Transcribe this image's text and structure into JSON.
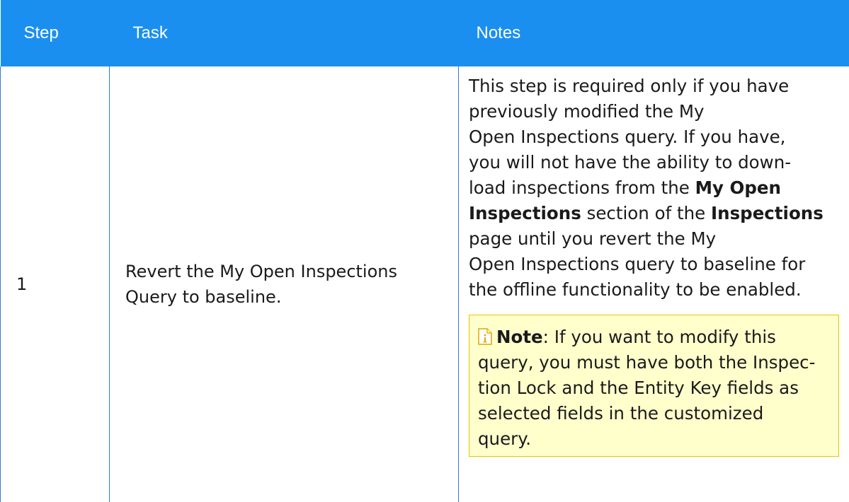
{
  "table": {
    "headers": {
      "step": "Step",
      "task": "Task",
      "notes": "Notes"
    },
    "rows": [
      {
        "step": "1",
        "task_lines": [
          "Revert the My Open Inspections",
          "Query to baseline."
        ],
        "notes_lines": {
          "l1": "This step is required only if you have",
          "l2": "previously modified the My",
          "l3": "Open Inspections query. If you have,",
          "l4": "you will not have the ability to down-",
          "l5_pre": "load inspections from the ",
          "l5_bold": "My Open",
          "l6_bold1": "Inspections",
          "l6_mid": " section of the ",
          "l6_bold2": "Inspections",
          "l7": "page until you revert the My",
          "l8": "Open Inspections query to baseline for",
          "l9": "the offline functionality to be enabled."
        },
        "note": {
          "icon": "note-info-icon",
          "label": "Note",
          "colon": ":",
          "lines": [
            " If you want to modify this",
            "query, you must have both the Inspec-",
            "tion Lock and the Entity Key fields as",
            "selected fields in the customized",
            "query."
          ]
        }
      }
    ]
  },
  "colors": {
    "header_bg": "#1a8ff0",
    "header_text": "#ffffff",
    "note_bg": "#ffffcc",
    "note_border": "#e8c400",
    "cell_border": "#2b7bd6"
  }
}
